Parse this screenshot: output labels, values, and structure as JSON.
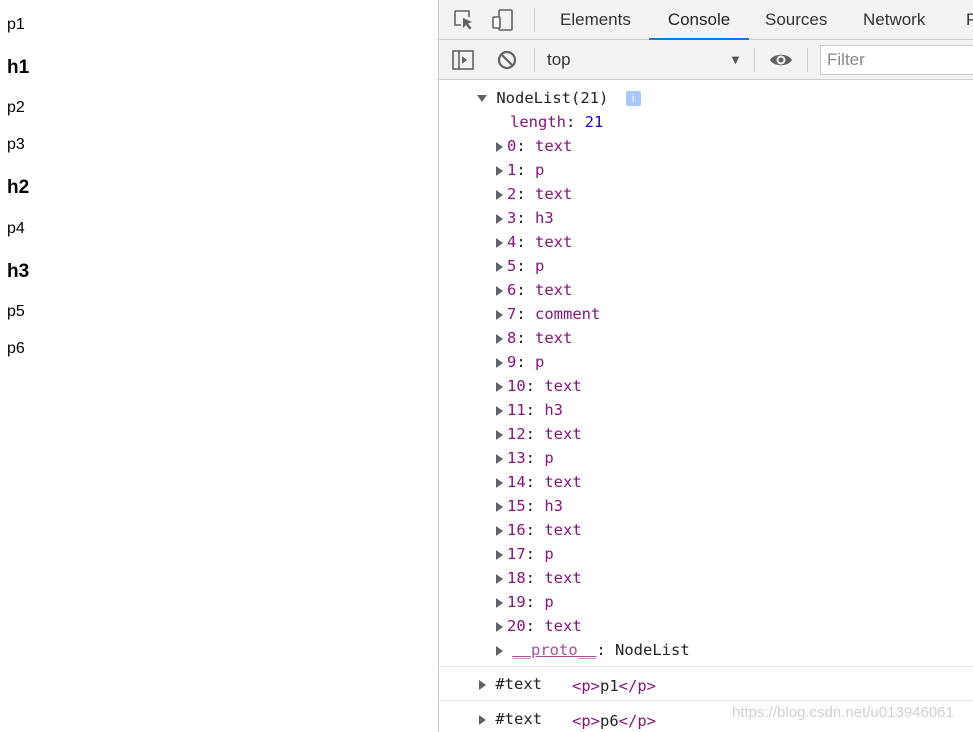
{
  "page": {
    "lines": [
      {
        "text": "p1",
        "kind": "p"
      },
      {
        "text": "h1",
        "kind": "h"
      },
      {
        "text": "p2",
        "kind": "p"
      },
      {
        "text": "p3",
        "kind": "p"
      },
      {
        "text": "h2",
        "kind": "h"
      },
      {
        "text": "p4",
        "kind": "p"
      },
      {
        "text": "h3",
        "kind": "h"
      },
      {
        "text": "p5",
        "kind": "p"
      },
      {
        "text": "p6",
        "kind": "p"
      }
    ]
  },
  "devtools": {
    "tabs": [
      "Elements",
      "Console",
      "Sources",
      "Network",
      "P"
    ],
    "active_tab": "Console",
    "accent_color": "#1a73e8",
    "toolbar": {
      "context": "top",
      "filter_placeholder": "Filter"
    },
    "icons": {
      "inspect": "inspect-element-icon",
      "device": "device-toolbar-icon",
      "sidebar": "sidebar-toggle-icon",
      "clear": "clear-console-icon",
      "eye": "live-expression-eye-icon",
      "dropdown": "dropdown-arrow-icon",
      "info": "info-icon"
    },
    "console": {
      "nodelist_header": "NodeList(21)",
      "info_badge": "i",
      "length_key": "length",
      "length_value": "21",
      "items": [
        {
          "index": "0",
          "type": "text"
        },
        {
          "index": "1",
          "type": "p"
        },
        {
          "index": "2",
          "type": "text"
        },
        {
          "index": "3",
          "type": "h3"
        },
        {
          "index": "4",
          "type": "text"
        },
        {
          "index": "5",
          "type": "p"
        },
        {
          "index": "6",
          "type": "text"
        },
        {
          "index": "7",
          "type": "comment"
        },
        {
          "index": "8",
          "type": "text"
        },
        {
          "index": "9",
          "type": "p"
        },
        {
          "index": "10",
          "type": "text"
        },
        {
          "index": "11",
          "type": "h3"
        },
        {
          "index": "12",
          "type": "text"
        },
        {
          "index": "13",
          "type": "p"
        },
        {
          "index": "14",
          "type": "text"
        },
        {
          "index": "15",
          "type": "h3"
        },
        {
          "index": "16",
          "type": "text"
        },
        {
          "index": "17",
          "type": "p"
        },
        {
          "index": "18",
          "type": "text"
        },
        {
          "index": "19",
          "type": "p"
        },
        {
          "index": "20",
          "type": "text"
        }
      ],
      "proto_key": "__proto__",
      "proto_value": "NodeList",
      "messages": [
        {
          "label": "#text",
          "open_tag": "<p>",
          "content": "p1",
          "close_tag": "</p>"
        },
        {
          "label": "#text",
          "open_tag": "<p>",
          "content": "p6",
          "close_tag": "</p>"
        }
      ]
    }
  },
  "watermark": "https://blog.csdn.net/u013946061"
}
